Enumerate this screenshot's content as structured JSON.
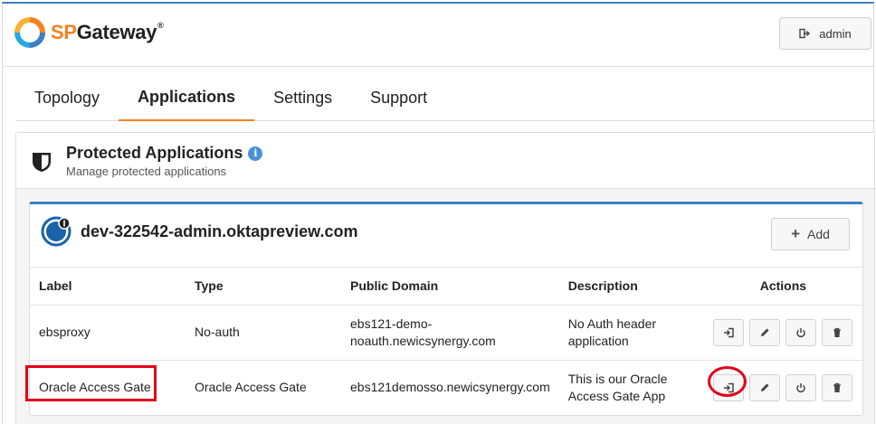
{
  "header": {
    "logo_sp": "SP",
    "logo_gateway": "Gateway",
    "logo_mark": "®",
    "admin_label": "admin"
  },
  "tabs": [
    {
      "label": "Topology",
      "active": false
    },
    {
      "label": "Applications",
      "active": true
    },
    {
      "label": "Settings",
      "active": false
    },
    {
      "label": "Support",
      "active": false
    }
  ],
  "panel": {
    "title": "Protected Applications",
    "subtitle": "Manage protected applications",
    "info_icon_glyph": "i"
  },
  "card": {
    "title": "dev-322542-admin.oktapreview.com",
    "add_label": "Add",
    "add_icon_glyph": "+"
  },
  "table": {
    "columns": [
      "Label",
      "Type",
      "Public Domain",
      "Description",
      "Actions"
    ],
    "rows": [
      {
        "label": "ebsproxy",
        "type": "No-auth",
        "domain_line1": "ebs121-demo-",
        "domain_line2": "noauth.newicsynergy.com",
        "desc_line1": "No Auth header",
        "desc_line2": "application"
      },
      {
        "label": "Oracle Access Gate",
        "type": "Oracle Access Gate",
        "domain_line1": "ebs121demosso.newicsynergy.com",
        "domain_line2": "",
        "desc_line1": "This is our Oracle",
        "desc_line2": "Access Gate App"
      }
    ]
  },
  "icons": {
    "admin": "sign-out-icon",
    "login": "sign-in-icon",
    "edit": "pencil-icon",
    "power": "power-icon",
    "delete": "trash-icon"
  },
  "colors": {
    "accent_blue": "#3b7fc4",
    "accent_orange": "#f58220",
    "highlight_red": "#e2001a",
    "info_blue": "#4a90d9"
  }
}
